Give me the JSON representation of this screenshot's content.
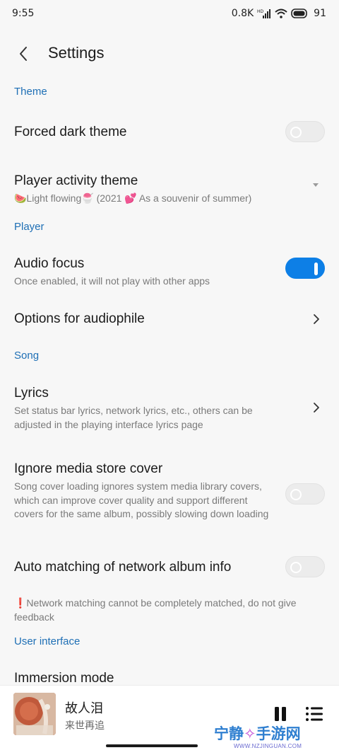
{
  "status_bar": {
    "time": "9:55",
    "speed": "0.8K",
    "battery": "91"
  },
  "header": {
    "title": "Settings"
  },
  "sections": {
    "theme": "Theme",
    "player": "Player",
    "song": "Song",
    "user_interface": "User interface"
  },
  "rows": {
    "forced_dark": {
      "title": "Forced dark theme",
      "enabled": false
    },
    "player_activity_theme": {
      "title": "Player activity theme",
      "value": "🍉Light flowing🍧 (2021 💕 As a souvenir of summer)"
    },
    "audio_focus": {
      "title": "Audio focus",
      "subtitle": "Once enabled, it will not play with other apps",
      "enabled": true
    },
    "audiophile": {
      "title": "Options for audiophile"
    },
    "lyrics": {
      "title": "Lyrics",
      "subtitle": "Set status bar lyrics, network lyrics, etc., others can be adjusted in the playing interface lyrics page"
    },
    "ignore_cover": {
      "title": "Ignore media store cover",
      "subtitle": "Song cover loading ignores system media library covers, which can improve cover quality and support different covers for the same album, possibly slowing down loading",
      "enabled": false
    },
    "auto_matching": {
      "title": "Auto matching of network album info",
      "note": "❗Network matching cannot be completely matched, do not give feedback",
      "enabled": false
    },
    "immersion": {
      "title": "Immersion mode"
    }
  },
  "mini_player": {
    "song_title": "故人泪",
    "artist": "来世再追"
  },
  "watermark": {
    "text": "宁静",
    "text2": "手游网",
    "url": "WWW.NZJINGUAN.COM"
  },
  "colors": {
    "accent": "#1e6fb5",
    "toggle_on": "#0d7fe6"
  }
}
